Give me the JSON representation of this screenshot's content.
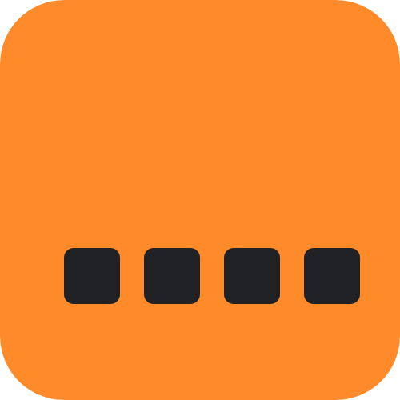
{
  "icon": {
    "name": "app-icon",
    "background_color": "#FF8A2A",
    "square_color": "#202124",
    "square_count": 4
  }
}
